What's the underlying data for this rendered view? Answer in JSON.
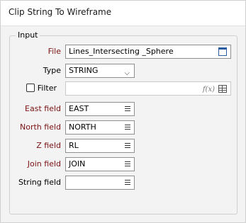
{
  "window": {
    "title": "Clip String To Wireframe"
  },
  "input_group": {
    "legend": "Input",
    "file": {
      "label": "File",
      "value": "Lines_Intersecting _Sphere",
      "icon": "browse-icon"
    },
    "type": {
      "label": "Type",
      "value": "STRING",
      "icon": "chevron-down-icon"
    },
    "filter": {
      "label": "Filter",
      "checked": false,
      "value": "",
      "fx_label": "f(x)"
    },
    "east_field": {
      "label": "East field",
      "value": "EAST"
    },
    "north_field": {
      "label": "North field",
      "value": "NORTH"
    },
    "z_field": {
      "label": "Z field",
      "value": "RL"
    },
    "join_field": {
      "label": "Join field",
      "value": "JOIN"
    },
    "string_field": {
      "label": "String field",
      "value": ""
    }
  },
  "colors": {
    "required_label": "#7a1212",
    "window_bg": "#f3f3f3",
    "border": "#8f8f8f"
  }
}
